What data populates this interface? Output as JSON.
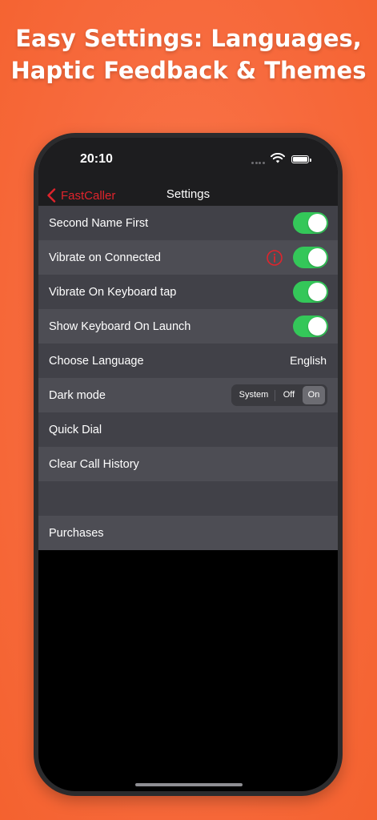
{
  "headline": {
    "line1": "Easy Settings: Languages,",
    "line2": "Haptic Feedback & Themes"
  },
  "status_bar": {
    "time": "20:10",
    "icons": [
      "signal-dots-icon",
      "wifi-icon",
      "battery-icon"
    ]
  },
  "nav": {
    "back_label": "FastCaller",
    "title": "Settings"
  },
  "colors": {
    "background": "#f76a3d",
    "accent_red": "#e0242c",
    "toggle_on": "#34c759",
    "row_a": "#414148",
    "row_b": "#4d4d54"
  },
  "settings": {
    "second_name_first": {
      "label": "Second Name First",
      "enabled": true
    },
    "vibrate_on_connected": {
      "label": "Vibrate on Connected",
      "enabled": true,
      "info_icon": "info-circle-icon"
    },
    "vibrate_keyboard_tap": {
      "label": "Vibrate On Keyboard tap",
      "enabled": true
    },
    "show_keyboard_launch": {
      "label": "Show Keyboard On Launch",
      "enabled": true
    },
    "choose_language": {
      "label": "Choose Language",
      "value": "English"
    },
    "dark_mode": {
      "label": "Dark mode",
      "options": [
        "System",
        "Off",
        "On"
      ],
      "selected": "On"
    },
    "quick_dial": {
      "label": "Quick Dial"
    },
    "clear_call_history": {
      "label": "Clear Call History"
    },
    "purchases": {
      "label": "Purchases"
    }
  }
}
